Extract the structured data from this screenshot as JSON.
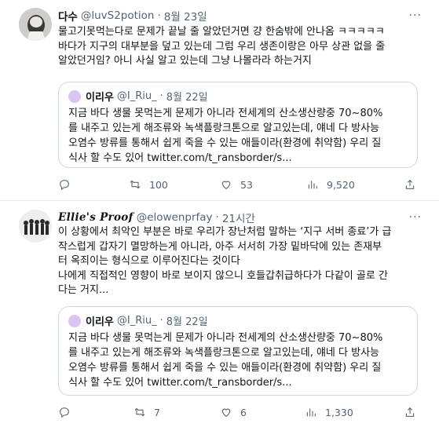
{
  "tweets": [
    {
      "name": "다수",
      "handle": "@luvS2potion",
      "sep": "·",
      "time": "8월 23일",
      "more": "···",
      "lines": [
        "물고기못먹는다로 문제가 끝날 줄 알았던거면 걍 한숨밖에 안나옴 ㅋㅋㅋㅋㅋ",
        "바다가 지구의 대부분을 덮고 있는데 그럼 우리 생존이랑은 아무 상관 없을 줄",
        "알았던거임? 아니 사실 알고 있는데 그냥 나몰라라 하는거지"
      ],
      "quote": {
        "name": "이리우",
        "handle": "@I_Riu_",
        "sep": "·",
        "time": "8월 22일",
        "lines": [
          "지금 바다 생물 못먹는게 문제가 아니라 전세계의 산소생산량중 70~80%",
          "를 내주고 있는게 해조류와 녹색플랑크톤으로 알고있는데, 얘네 다 방사능",
          "오염수 방류를 통해서 쉽게 죽을 수 있는 애들이라(환경에 취약함) 우리 질",
          "식사 할 수도 있어 twitter.com/t_ransborder/s..."
        ]
      },
      "actions": {
        "replies": "",
        "retweets": "100",
        "likes": "53",
        "views": "9,520"
      }
    },
    {
      "name": "Ellie's Proof",
      "handle": "@elowenprfay",
      "sep": "·",
      "time": "21시간",
      "more": "···",
      "lines": [
        "이 상황에서 최악인 부분은 바로 우리가 장난처럼 말하는 ‘지구 서버 종료’가 급",
        "작스럽게 갑자기 멸망하는게 아니라, 아주 서서히 가장 밑바닥에 있는 존재부",
        "터 옥죄이는 형식으로 이루어진다는 것이다",
        "나에게 직접적인 영향이 바로 보이지 않으니 호들갑취급하다가 다같이 골로 간",
        "다는 거지..."
      ],
      "quote": {
        "name": "이리우",
        "handle": "@I_Riu_",
        "sep": "·",
        "time": "8월 22일",
        "lines": [
          "지금 바다 생물 못먹는게 문제가 아니라 전세계의 산소생산량중 70~80%",
          "를 내주고 있는게 해조류와 녹색플랑크톤으로 알고있는데, 얘네 다 방사능",
          "오염수 방류를 통해서 쉽게 죽을 수 있는 애들이라(환경에 취약함) 우리 질",
          "식사 할 수도 있어 twitter.com/t_ransborder/s..."
        ]
      },
      "actions": {
        "replies": "",
        "retweets": "7",
        "likes": "6",
        "views": "1,330"
      }
    }
  ]
}
